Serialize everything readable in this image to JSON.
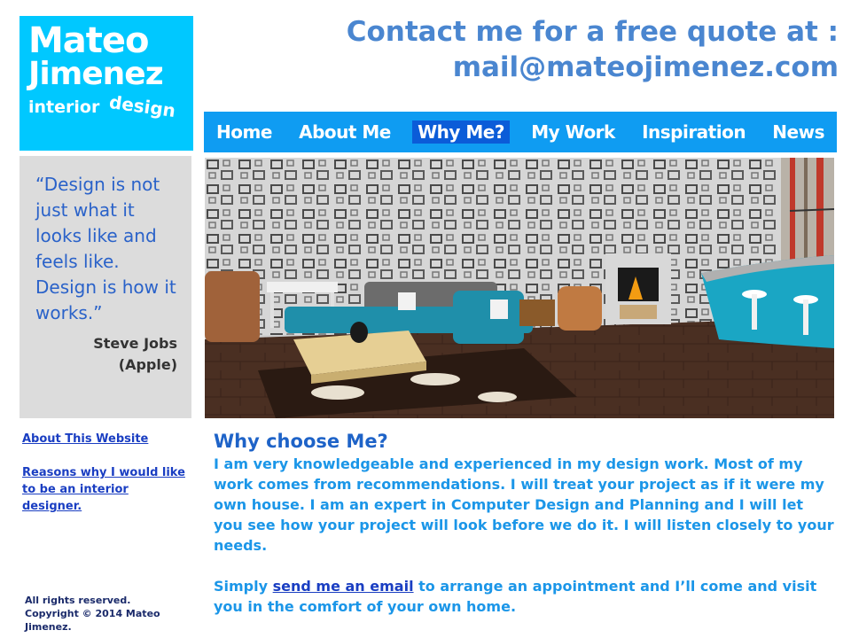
{
  "logo": {
    "line1": "Mateo",
    "line2": "Jimenez",
    "line3a": "interior",
    "line3b": "design"
  },
  "contact": {
    "line1": "Contact me for a free quote at :",
    "line2": "mail@mateojimenez.com"
  },
  "nav": {
    "items": [
      "Home",
      "About Me",
      "Why Me?",
      "My Work",
      "Inspiration",
      "News"
    ],
    "active_index": 2
  },
  "quote": {
    "text": "“Design is not just what it looks like and feels like. Design is how it works.”",
    "author_line1": "Steve Jobs",
    "author_line2": "(Apple)"
  },
  "side_links": {
    "about_website": "About This Website",
    "reasons": "Reasons why I would like to be an interior designer."
  },
  "main": {
    "heading": "Why choose Me?",
    "paragraph1": "I am very knowledgeable and experienced in my design work. Most of my work comes from recommendations. I will treat your project as if it were my own house. I am an expert in Computer Design and Planning and I will let you see how your project will look before we do it. I will listen closely to your needs.",
    "p2_before": "Simply ",
    "p2_link": "send me an email",
    "p2_after": " to arrange an appointment and I’ll come and visit you in the comfort of your own home."
  },
  "footer": {
    "line1": "All rights reserved.",
    "line2": "Copyright © 2014 Mateo Jimenez."
  },
  "colors": {
    "logo_bg": "#00c8ff",
    "nav_bg": "#0f9cf2",
    "nav_active": "#0b5cd8",
    "contact_text": "#4a86d0",
    "quote_text": "#2a62c9",
    "body_text": "#1b96e8",
    "link": "#1a3ec2"
  }
}
